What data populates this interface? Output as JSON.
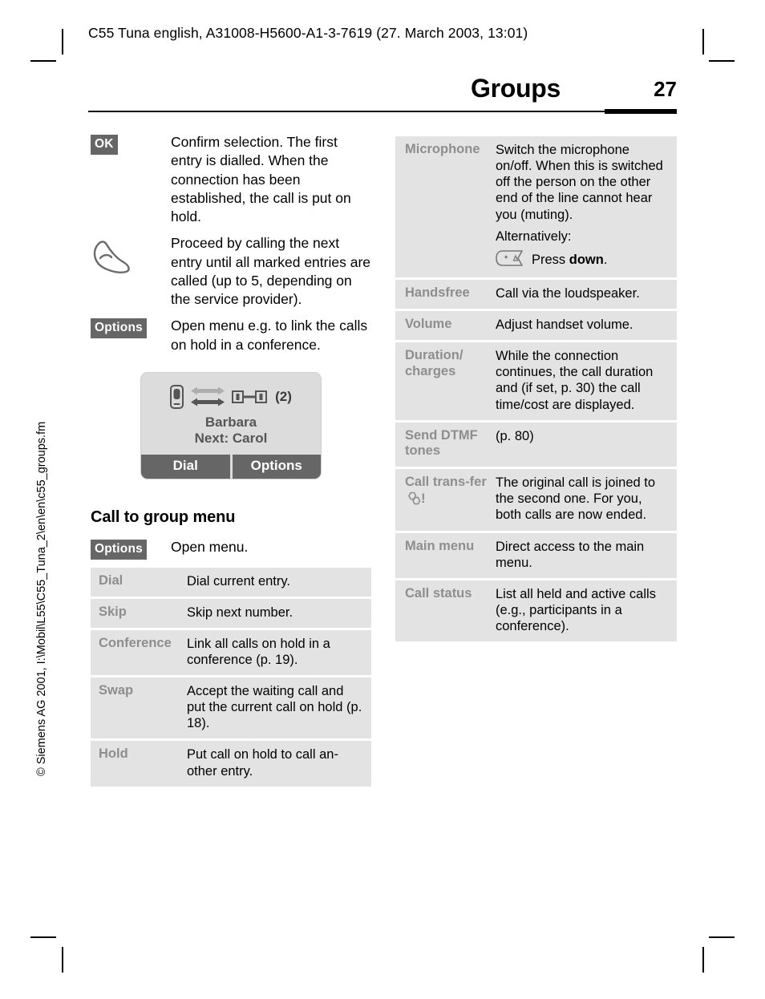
{
  "header": {
    "running_head": "C55 Tuna english, A31008-H5600-A1-3-7619 (27. March 2003, 13:01)"
  },
  "title_bar": {
    "chapter_title": "Groups",
    "page_number": "27"
  },
  "spine": {
    "text": "© Siemens AG 2001, I:\\Mobil\\L55\\C55_Tuna_2\\en\\en\\c55_groups.fm"
  },
  "left_column": {
    "definitions": [
      {
        "key_label": "OK",
        "key_type": "softkey",
        "text": "Confirm selection. The first entry is dialled. When the connection has been established, the call is put on hold."
      },
      {
        "key_label": "",
        "key_type": "hand-icon",
        "text": "Proceed by calling the next entry until all marked entries are called (up to 5, depending on the service provider)."
      },
      {
        "key_label": "Options",
        "key_type": "softkey",
        "text": "Open menu e.g. to link the calls on hold in a conference."
      }
    ],
    "phone_mock": {
      "handset_icon": "handset-icon",
      "arrow_up_icon": "arrow-double-light-icon",
      "arrow_down_icon": "arrow-double-dark-icon",
      "hold_icon": "call-hold-icon",
      "call_count": "(2)",
      "active_name": "Barbara",
      "next_line": "Next: Carol",
      "left_softkey": "Dial",
      "right_softkey": "Options"
    },
    "section": {
      "heading": "Call to group menu",
      "intro_key": "Options",
      "intro_text": "Open menu.",
      "table": [
        {
          "label": "Dial",
          "desc": "Dial current entry."
        },
        {
          "label": "Skip",
          "desc": "Skip next number."
        },
        {
          "label": "Conference",
          "desc": "Link all calls on hold in a conference (p. 19)."
        },
        {
          "label": "Swap",
          "desc": "Accept the waiting call and put the current call on hold (p. 18)."
        },
        {
          "label": "Hold",
          "desc": "Put call on hold to call an-other entry."
        }
      ]
    }
  },
  "right_column": {
    "table": [
      {
        "label": "Microphone",
        "desc": "Switch the microphone on/off. When this is switched off the person on the other end of the line cannot hear you (muting).",
        "desc2": "Alternatively:",
        "key_icon": "star-key-icon",
        "key_text_pre": "Press ",
        "key_text_bold": "down",
        "key_text_post": "."
      },
      {
        "label": "Handsfree",
        "desc": "Call via the loudspeaker."
      },
      {
        "label": "Volume",
        "desc": "Adjust handset volume."
      },
      {
        "label": "Duration/ charges",
        "desc": "While the connection continues, the call duration and (if set, p. 30) the call time/cost are displayed."
      },
      {
        "label": "Send DTMF tones",
        "desc": "(p. 80)"
      },
      {
        "label": "Call trans-fer",
        "label_icon": "network-service-icon",
        "label_bang": "!",
        "desc": "The original call is joined to the second one. For you, both calls are now ended."
      },
      {
        "label": "Main menu",
        "desc": "Direct access to the main menu."
      },
      {
        "label": "Call status",
        "desc": "List all held and active calls (e.g., participants in a conference)."
      }
    ]
  },
  "colors": {
    "softkey_bg": "#666666",
    "table_bg": "#e3e3e3",
    "label_gray": "#8e8e8e",
    "mock_bg": "#dcdcdc"
  }
}
